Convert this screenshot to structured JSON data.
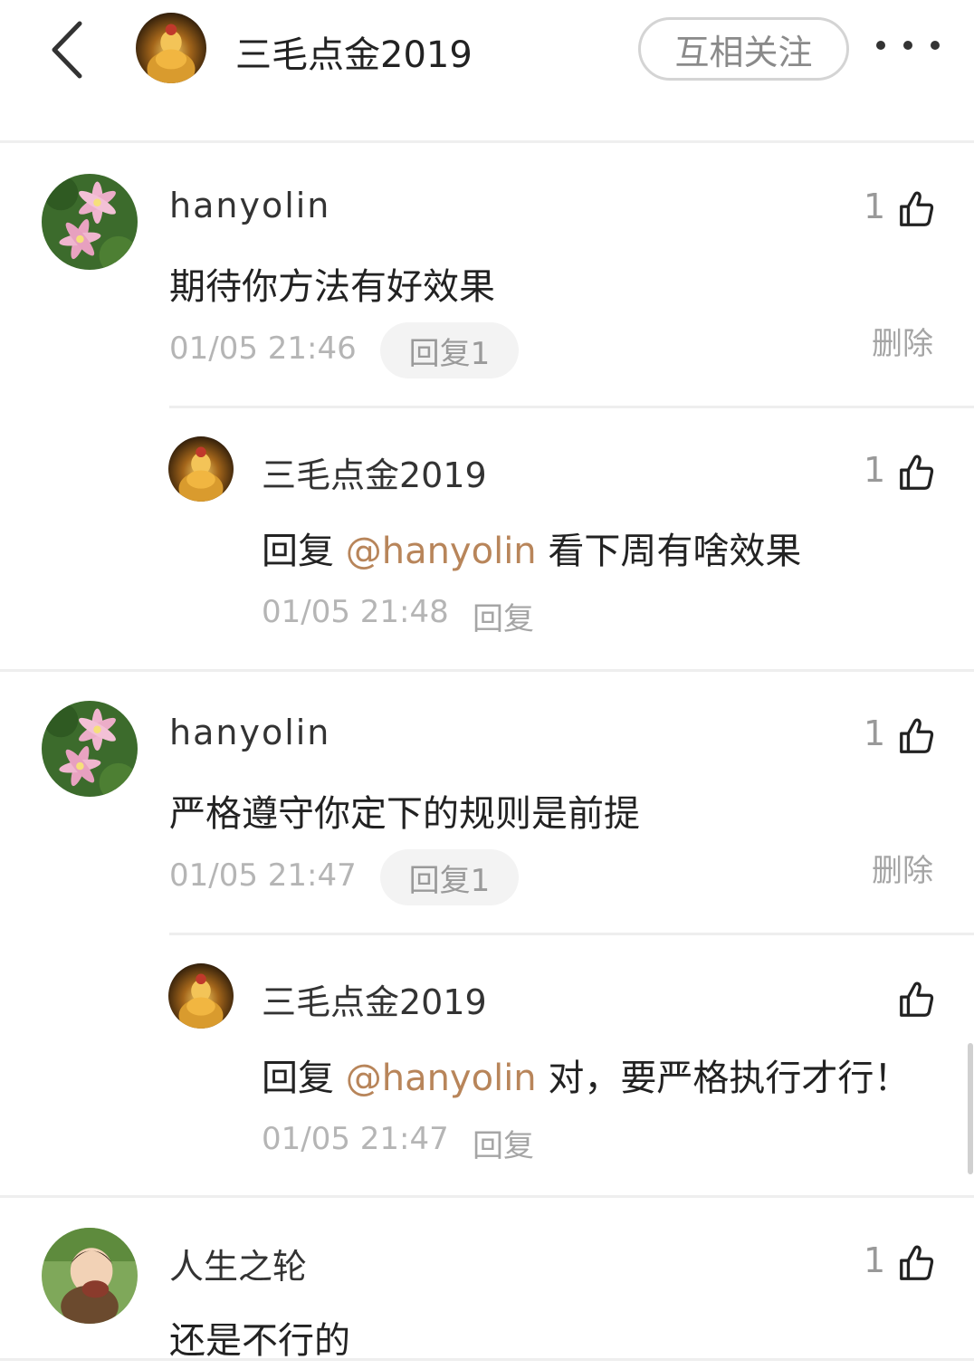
{
  "header": {
    "author_name": "三毛点金2019",
    "follow_label": "互相关注"
  },
  "comments": [
    {
      "username": "hanyolin",
      "text": "期待你方法有好效果",
      "time": "01/05 21:46",
      "reply_label": "回复1",
      "delete_label": "删除",
      "likes": "1",
      "reply": {
        "username": "三毛点金2019",
        "prefix": "回复",
        "mention": "@hanyolin",
        "text": "看下周有啥效果",
        "time": "01/05 21:48",
        "reply_label": "回复",
        "likes": "1"
      }
    },
    {
      "username": "hanyolin",
      "text": "严格遵守你定下的规则是前提",
      "time": "01/05 21:47",
      "reply_label": "回复1",
      "delete_label": "删除",
      "likes": "1",
      "reply": {
        "username": "三毛点金2019",
        "prefix": "回复",
        "mention": "@hanyolin",
        "text": "对，要严格执行才行！",
        "time": "01/05 21:47",
        "reply_label": "回复",
        "likes": ""
      }
    },
    {
      "username": "人生之轮",
      "text": "还是不行的",
      "likes": "1"
    }
  ],
  "colors": {
    "mention": "#b8855a",
    "muted": "#b5b5b5"
  },
  "icons": [
    "back-arrow-icon",
    "more-dots-icon",
    "thumbs-up-icon"
  ]
}
